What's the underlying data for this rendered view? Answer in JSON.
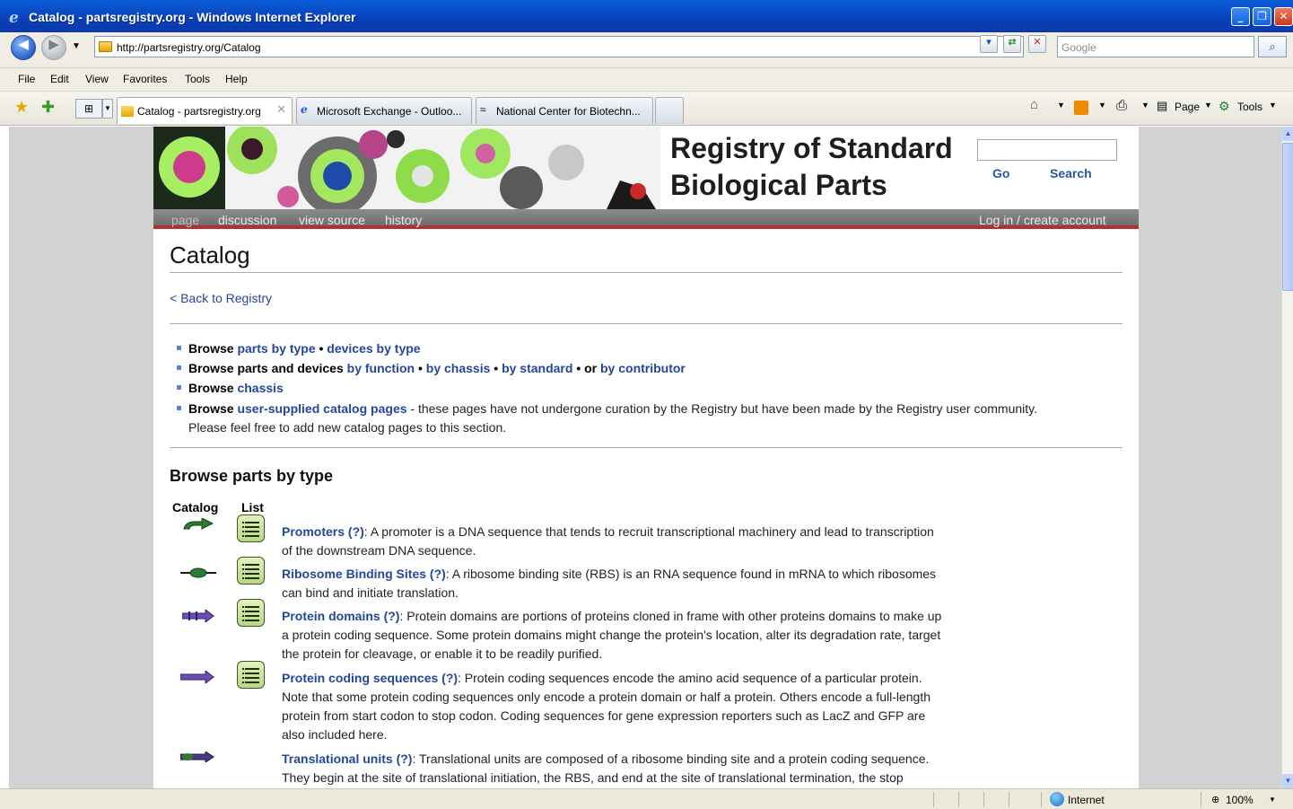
{
  "window": {
    "title": "Catalog - partsregistry.org - Windows Internet Explorer"
  },
  "address": {
    "url": "http://partsregistry.org/Catalog",
    "search_placeholder": "Google"
  },
  "menu": [
    "File",
    "Edit",
    "View",
    "Favorites",
    "Tools",
    "Help"
  ],
  "tabs": [
    {
      "label": "Catalog - partsregistry.org"
    },
    {
      "label": "Microsoft Exchange - Outloo..."
    },
    {
      "label": "National Center for Biotechn..."
    }
  ],
  "command_bar": {
    "page": "Page",
    "tools": "Tools"
  },
  "site": {
    "title_line1": "Registry of Standard",
    "title_line2": "Biological Parts",
    "go": "Go",
    "search": "Search",
    "page_tabs": [
      "page",
      "discussion",
      "view source",
      "history"
    ],
    "login": "Log in / create account"
  },
  "content": {
    "heading": "Catalog",
    "back_link": "< Back to Registry",
    "browse": {
      "b1_prefix": "Browse",
      "b1_link1": "parts by type",
      "b1_sep": "•",
      "b1_link2": "devices by type",
      "b2_prefix": "Browse parts and devices",
      "b2_link1": "by function",
      "b2_link2": "by chassis",
      "b2_link3": "by standard",
      "b2_or": "• or",
      "b2_link4": "by contributor",
      "b3_prefix": "Browse",
      "b3_link": "chassis",
      "b4_prefix": "Browse",
      "b4_link": "user-supplied catalog pages",
      "b4_text": " - these pages have not undergone curation by the Registry but have been made by the Registry user community.",
      "b4_text2": "Please feel free to add new catalog pages to this section."
    },
    "section_title": "Browse parts by type",
    "col_catalog": "Catalog",
    "col_list": "List",
    "items": [
      {
        "name": "Promoters (?)",
        "lines": [
          ": A promoter is a DNA sequence that tends to recruit transcriptional machinery and lead to transcription",
          "of the downstream DNA sequence."
        ]
      },
      {
        "name": "Ribosome Binding Sites (?)",
        "lines": [
          ": A ribosome binding site (RBS) is an RNA sequence found in mRNA to which ribosomes",
          "can bind and initiate translation."
        ]
      },
      {
        "name": "Protein domains (?)",
        "lines": [
          ": Protein domains are portions of proteins cloned in frame with other proteins domains to make up",
          "a protein coding sequence. Some protein domains might change the protein's location, alter its degradation rate, target",
          "the protein for cleavage, or enable it to be readily purified."
        ]
      },
      {
        "name": "Protein coding sequences (?)",
        "lines": [
          ": Protein coding sequences encode the amino acid sequence of a particular protein.",
          "Note that some protein coding sequences only encode a protein domain or half a protein. Others encode a full-length",
          "protein from start codon to stop codon. Coding sequences for gene expression reporters such as LacZ and GFP are",
          "also included here."
        ]
      },
      {
        "name": "Translational units (?)",
        "lines": [
          ": Translational units are composed of a ribosome binding site and a protein coding sequence.",
          "They begin at the site of translational initiation, the RBS, and end at the site of translational termination, the stop"
        ]
      }
    ]
  },
  "status": {
    "zone": "Internet",
    "zoom": "100%"
  }
}
